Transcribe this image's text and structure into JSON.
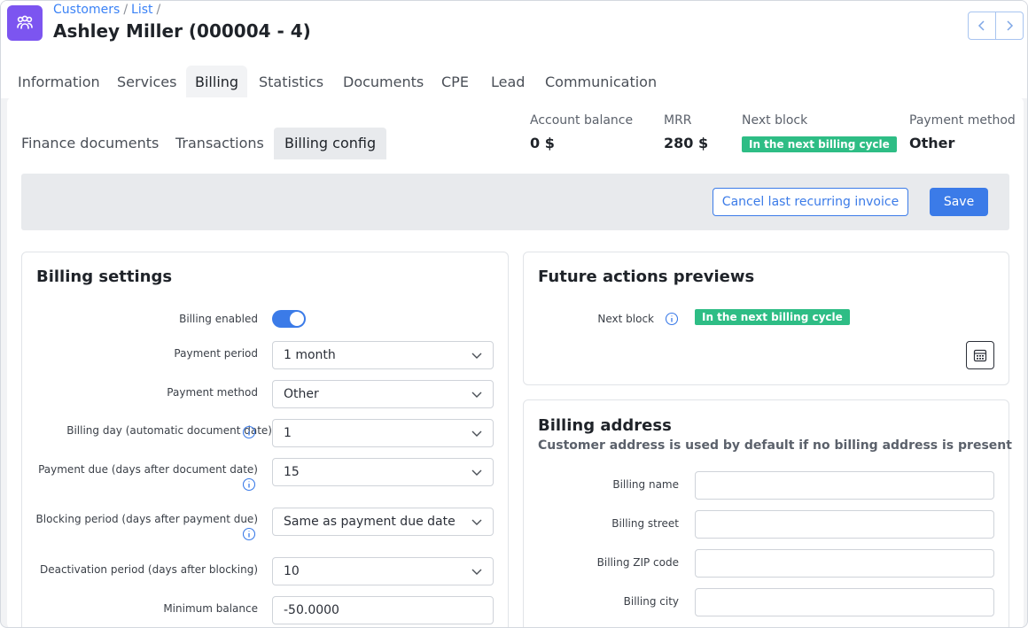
{
  "breadcrumb": {
    "customers": "Customers",
    "list": "List"
  },
  "page_title": "Ashley Miller (000004 - 4)",
  "tabs": [
    "Information",
    "Services",
    "Billing",
    "Statistics",
    "Documents",
    "CPE",
    "Lead",
    "Communication"
  ],
  "active_tab": "Billing",
  "subtabs": [
    "Finance documents",
    "Transactions",
    "Billing config"
  ],
  "active_subtab": "Billing config",
  "stats": {
    "balance_label": "Account balance",
    "balance_value": "0 $",
    "mrr_label": "MRR",
    "mrr_value": "280 $",
    "next_block_label": "Next block",
    "next_block_badge": "In the next billing cycle",
    "payment_method_label": "Payment method",
    "payment_method_value": "Other"
  },
  "actions": {
    "cancel_label": "Cancel last recurring invoice",
    "save_label": "Save"
  },
  "billing_settings": {
    "title": "Billing settings",
    "billing_enabled_label": "Billing enabled",
    "billing_enabled": true,
    "payment_period_label": "Payment period",
    "payment_period_value": "1 month",
    "payment_method_label": "Payment method",
    "payment_method_value": "Other",
    "billing_day_label": "Billing day (automatic document date)",
    "billing_day_value": "1",
    "payment_due_label": "Payment due (days after document date)",
    "payment_due_value": "15",
    "blocking_period_label": "Blocking period (days after payment due)",
    "blocking_period_value": "Same as payment due date",
    "deactivation_label": "Deactivation period (days after blocking)",
    "deactivation_value": "10",
    "min_balance_label": "Minimum balance",
    "min_balance_value": "-50.0000"
  },
  "future_actions": {
    "title": "Future actions previews",
    "next_block_label": "Next block",
    "next_block_badge": "In the next billing cycle"
  },
  "billing_address": {
    "title": "Billing address",
    "subtitle": "Customer address is used by default if no billing address is present",
    "name_label": "Billing name",
    "name_value": "",
    "street_label": "Billing street",
    "street_value": "",
    "zip_label": "Billing ZIP code",
    "zip_value": "",
    "city_label": "Billing city",
    "city_value": ""
  },
  "colors": {
    "accent": "#3b7be8",
    "badge": "#2ebd85",
    "app_icon": "#7c55f0"
  }
}
